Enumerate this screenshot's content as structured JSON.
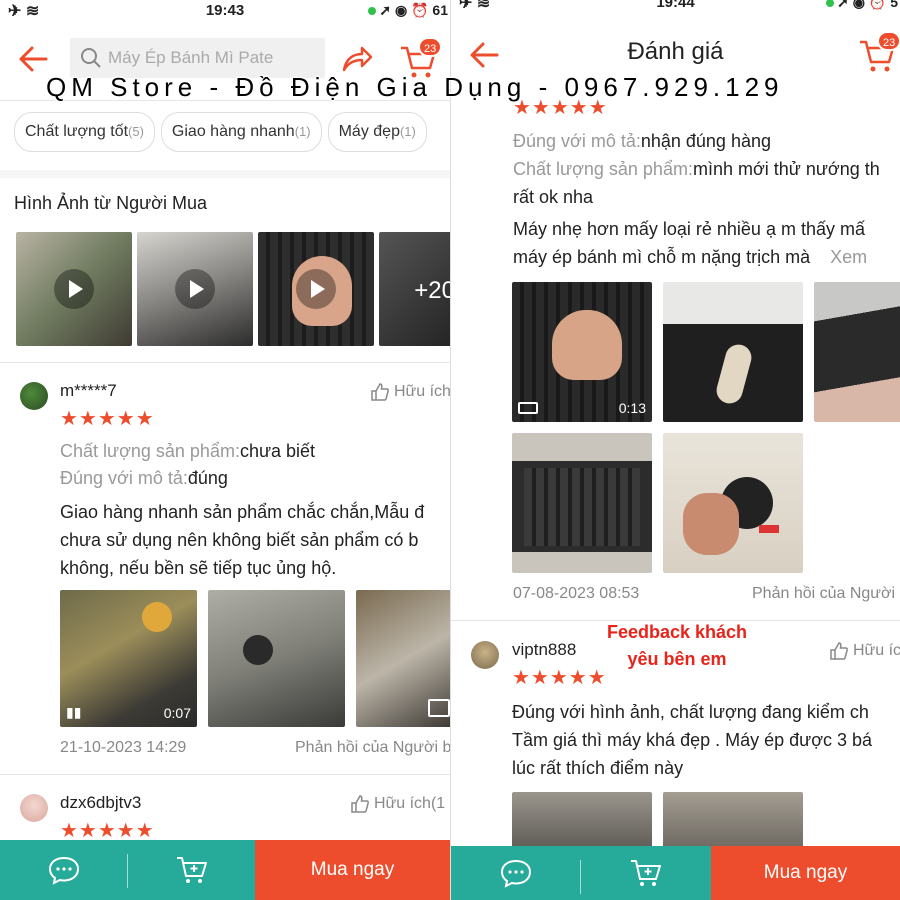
{
  "left": {
    "status": {
      "time": "19:43",
      "battery": "61"
    },
    "search": {
      "placeholder": "Máy Ép Bánh Mì Pate"
    },
    "cart_badge": "23",
    "chips": [
      {
        "label": "Chất lượng tốt",
        "count": "(5)"
      },
      {
        "label": "Giao hàng nhanh",
        "count": "(1)"
      },
      {
        "label": "Máy đẹp",
        "count": "(1)"
      }
    ],
    "buyer_images_title": "Hình Ảnh từ Người Mua",
    "buyer_images_more": "+20",
    "review1": {
      "username": "m*****7",
      "helpful": "Hữu ích",
      "stars": "★★★★★",
      "quality_label": "Chất lượng sản phẩm:",
      "quality_value": "chưa biết",
      "match_label": "Đúng với mô tả:",
      "match_value": "đúng",
      "text_lines": [
        "Giao hàng nhanh sản phẩm chắc chắn,Mẫu đ",
        "chưa sử dụng nên không biết sản phẩm có b",
        "không, nếu bền sẽ tiếp tục ủng hộ."
      ],
      "video_duration": "0:07",
      "date": "21-10-2023 14:29",
      "reply": "Phản hồi của Người b"
    },
    "review2": {
      "username": "dzx6dbjtv3",
      "helpful": "Hữu ích(1",
      "stars": "★★★★★"
    },
    "buy_now": "Mua ngay"
  },
  "right": {
    "status": {
      "time": "19:44",
      "battery": "5"
    },
    "title": "Đánh giá",
    "cart_badge": "23",
    "review1": {
      "stars": "★★★★★",
      "match_label": "Đúng với mô tả:",
      "match_value": "nhận đúng hàng",
      "quality_label": "Chất lượng sản phẩm:",
      "quality_value": "mình mới thử nướng th",
      "text_lines": [
        "rất ok nha",
        "Máy nhẹ hơn mấy loại rẻ nhiều ạ  m thấy mấ",
        "máy ép bánh mì chỗ m nặng trịch mà"
      ],
      "see_more": "Xem",
      "video_duration": "0:13",
      "date": "07-08-2023 08:53",
      "reply": "Phản hồi của Người"
    },
    "review2": {
      "username": "viptn888",
      "helpful": "Hữu íc",
      "stars": "★★★★★",
      "text_lines": [
        "Đúng với hình ảnh, chất lượng đang kiểm ch",
        "Tầm giá thì máy khá đẹp . Máy ép được 3 bá",
        "lúc rất thích điểm này"
      ]
    },
    "buy_now": "Mua ngay"
  },
  "overlay": {
    "watermark": "QM Store - Đồ Điện Gia Dụng - 0967.929.129",
    "feedback": "Feedback khách yêu bên em"
  },
  "colors": {
    "accent": "#ee4d2d",
    "teal": "#26aa99",
    "star": "#ee4d2d",
    "feedback": "#e8241a"
  }
}
